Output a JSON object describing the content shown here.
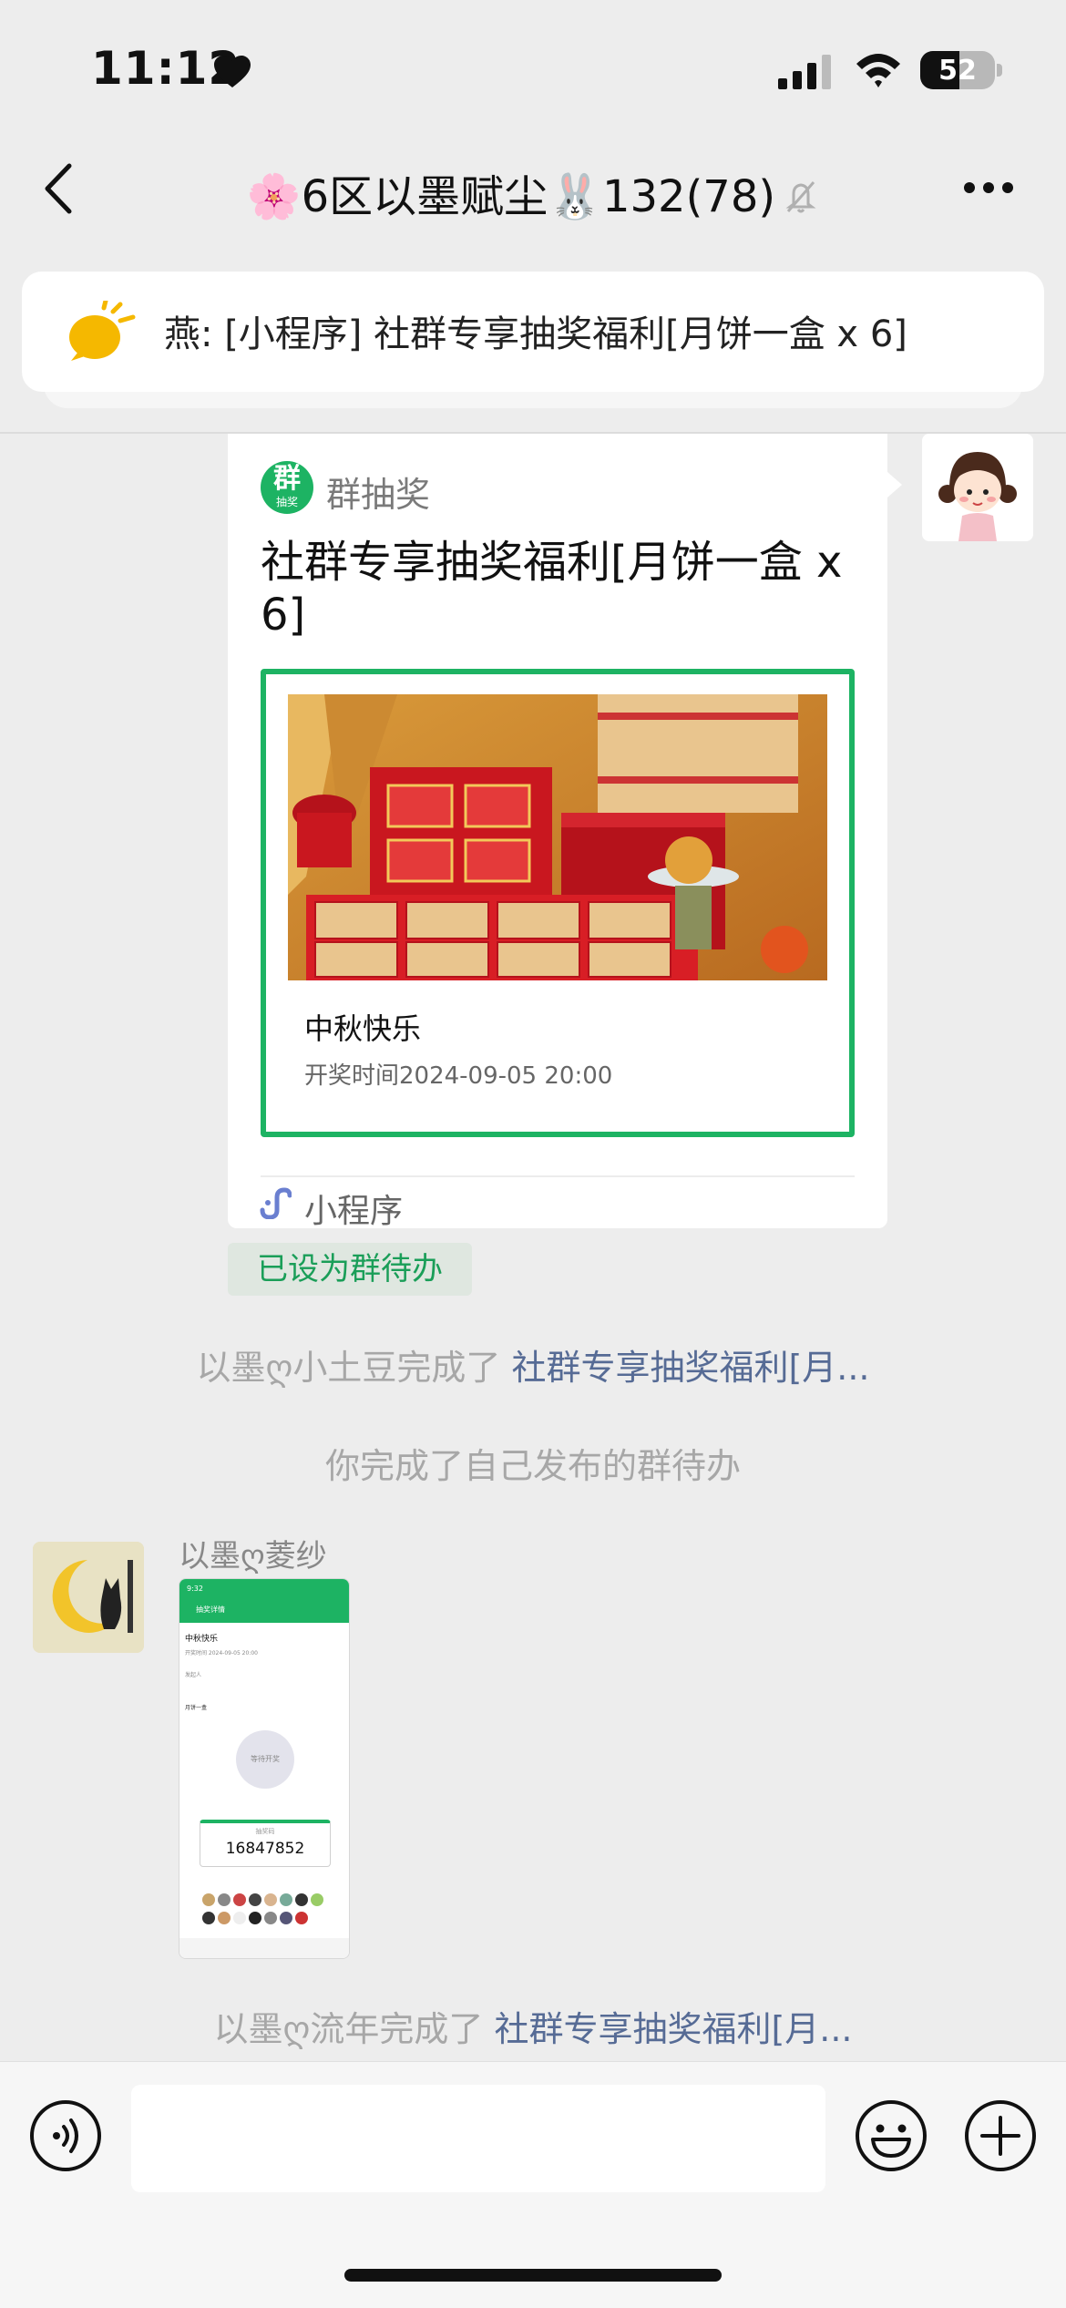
{
  "status_bar": {
    "time": "11:12",
    "battery": "52",
    "battery_level": 0.52
  },
  "nav": {
    "title": "🌸6区以墨赋尘🐰132(78)"
  },
  "pinned": {
    "text": "燕: [小程序] 社群专享抽奖福利[月饼一盒 x 6]"
  },
  "card": {
    "logo_main": "群",
    "logo_sub": "抽奖",
    "source": "群抽奖",
    "title": "社群专享抽奖福利[月饼一盒 x 6]",
    "prize_name": "中秋快乐",
    "draw_time": "开奖时间2024-09-05 20:00",
    "footer_label": "小程序",
    "todo_tag": "已设为群待办"
  },
  "system_messages": [
    {
      "actor": "以墨ღ小土豆完成了 ",
      "link": "社群专享抽奖福利[月..."
    },
    {
      "text": "你完成了自己发布的群待办"
    },
    {
      "actor": "以墨ღ流年完成了 ",
      "link": "社群专享抽奖福利[月..."
    }
  ],
  "other_message": {
    "sender": "以墨ღ菱纱",
    "screenshot": {
      "status_time": "9:32",
      "header": "抽奖详情",
      "title": "中秋快乐",
      "subtitle": "开奖时间 2024-09-05 20:00",
      "initiator": "发起人",
      "section": "月饼一盒",
      "button": "等待开奖",
      "code_label": "抽奖码",
      "code": "16847852"
    }
  },
  "input": {
    "placeholder": ""
  },
  "colors": {
    "accent_green": "#1db363",
    "link_blue": "#566b95",
    "background": "#ededed"
  }
}
